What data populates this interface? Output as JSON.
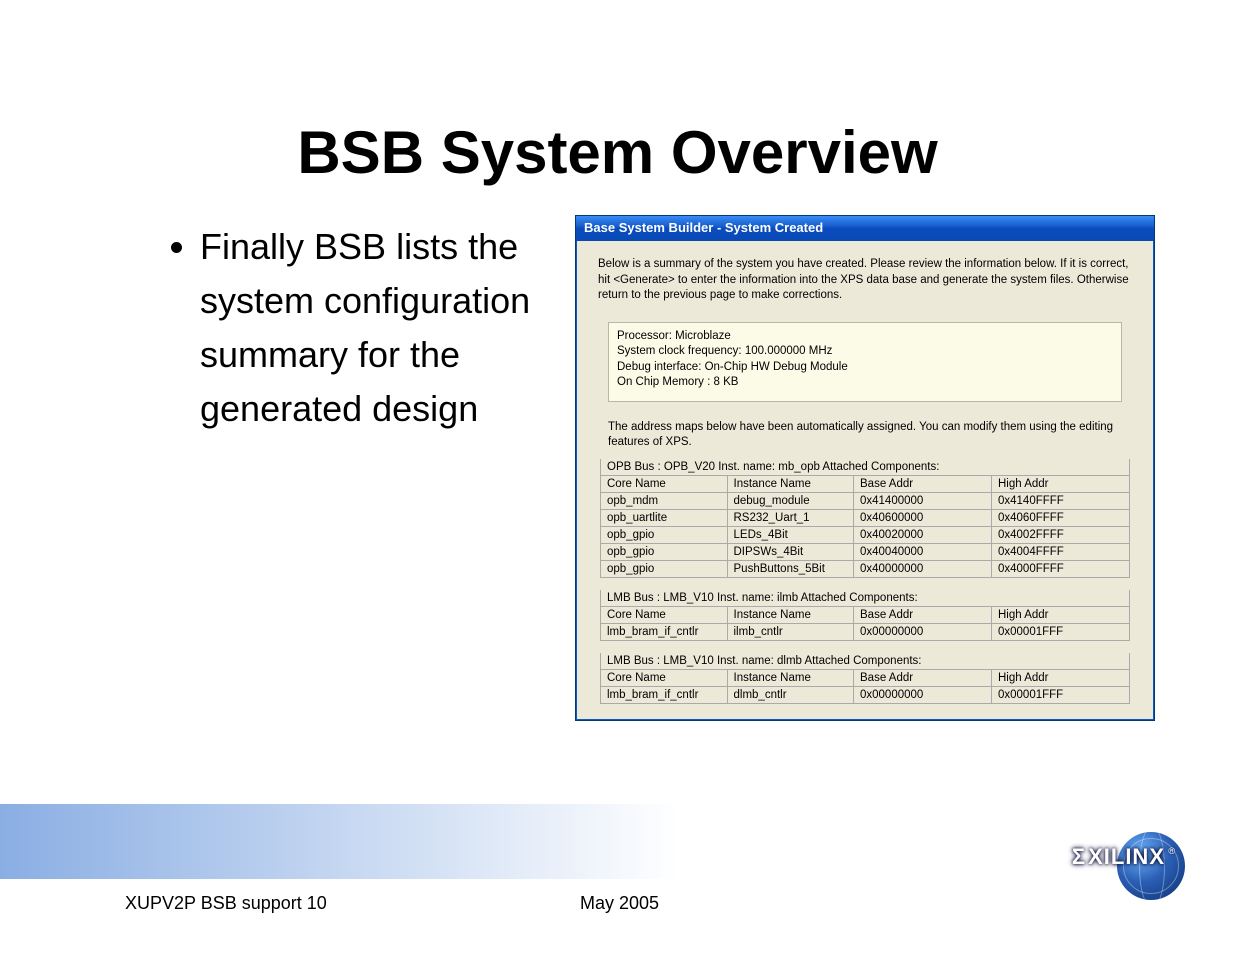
{
  "slide": {
    "title": "BSB System Overview",
    "bullet": "Finally BSB lists the system configuration summary for the generated design",
    "footer_left": "XUPV2P BSB support   10",
    "footer_center": "May 2005"
  },
  "window": {
    "titlebar": "Base System Builder  - System Created",
    "intro": "Below is a summary of the system you have created. Please review the information below. If it is correct, hit <Generate> to enter the information into the XPS data base and generate the system files. Otherwise return to the previous page to make corrections.",
    "summary": {
      "l1": "Processor: Microblaze",
      "l2": "System clock frequency: 100.000000 MHz",
      "l3": "Debug interface: On-Chip HW Debug Module",
      "l4": "On Chip Memory :   8 KB"
    },
    "addr_note": "The address maps below have been automatically assigned.  You can modify them using the editing features of XPS.",
    "tables": [
      {
        "header": "OPB Bus : OPB_V20  Inst. name: mb_opb   Attached Components:",
        "cols": [
          "Core Name",
          "Instance Name",
          "Base Addr",
          "High Addr"
        ],
        "rows": [
          [
            "opb_mdm",
            "debug_module",
            "0x41400000",
            "0x4140FFFF"
          ],
          [
            "opb_uartlite",
            "RS232_Uart_1",
            "0x40600000",
            "0x4060FFFF"
          ],
          [
            "opb_gpio",
            "LEDs_4Bit",
            "0x40020000",
            "0x4002FFFF"
          ],
          [
            "opb_gpio",
            "DIPSWs_4Bit",
            "0x40040000",
            "0x4004FFFF"
          ],
          [
            "opb_gpio",
            "PushButtons_5Bit",
            "0x40000000",
            "0x4000FFFF"
          ]
        ]
      },
      {
        "header": "LMB Bus : LMB_V10  Inst. name: ilmb   Attached Components:",
        "cols": [
          "Core Name",
          "Instance Name",
          "Base Addr",
          "High Addr"
        ],
        "rows": [
          [
            "lmb_bram_if_cntlr",
            "ilmb_cntlr",
            "0x00000000",
            "0x00001FFF"
          ]
        ]
      },
      {
        "header": "LMB Bus : LMB_V10  Inst. name: dlmb   Attached Components:",
        "cols": [
          "Core Name",
          "Instance Name",
          "Base Addr",
          "High Addr"
        ],
        "rows": [
          [
            "lmb_bram_if_cntlr",
            "dlmb_cntlr",
            "0x00000000",
            "0x00001FFF"
          ]
        ]
      }
    ]
  },
  "logo": {
    "text": "XILINX",
    "sigma": "Σ",
    "reg": "®"
  }
}
